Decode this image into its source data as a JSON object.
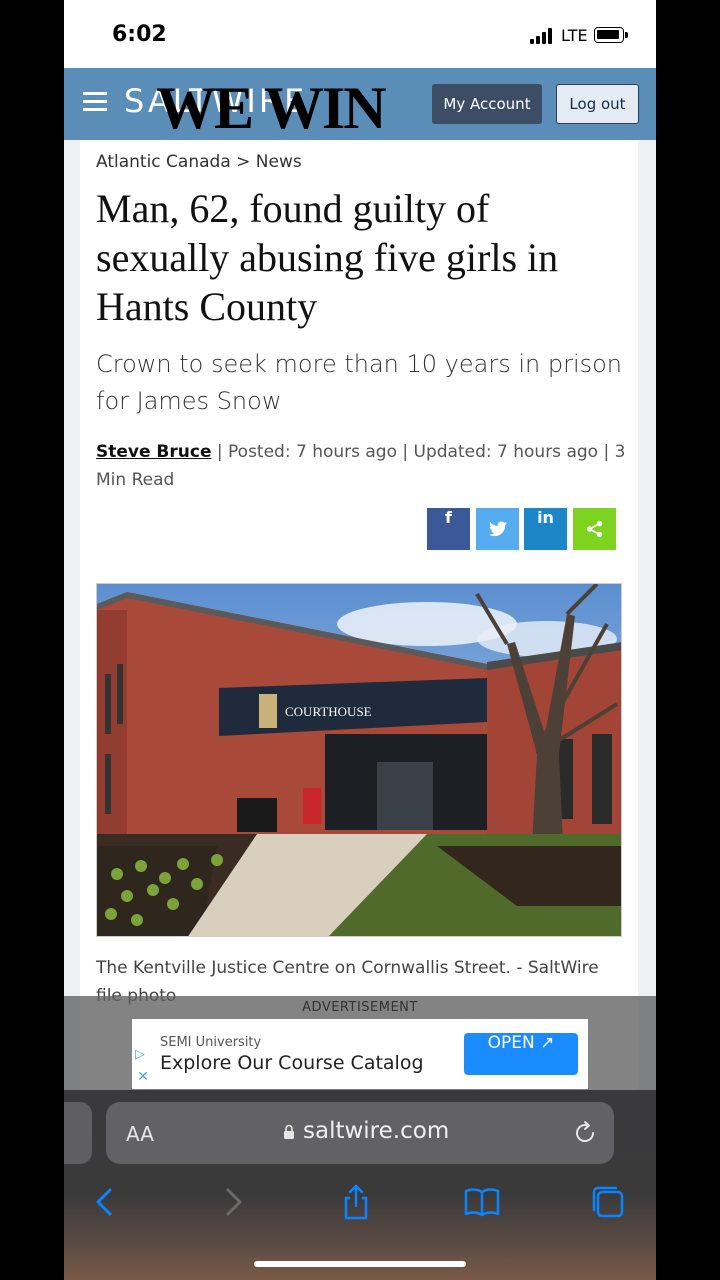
{
  "status_bar": {
    "time": "6:02",
    "network": "LTE"
  },
  "header": {
    "logo": "SALTWIRE",
    "overlay_text": "WE WIN",
    "account_label": "My Account",
    "logout_label": "Log out"
  },
  "article": {
    "breadcrumb": "Atlantic Canada > News",
    "headline": "Man, 62, found guilty of sexually abusing five girls in Hants County",
    "subheadline": "Crown to seek more than 10 years in prison for James Snow",
    "author": "Steve Bruce",
    "meta": " | Posted: 7 hours ago | Updated: 7 hours ago | 3 Min Read",
    "share": {
      "facebook": "f",
      "twitter": "t",
      "linkedin": "in"
    },
    "photo_sign": "COURTHOUSE",
    "caption": "The Kentville Justice Centre on Cornwallis Street. - SaltWire file photo"
  },
  "ad": {
    "label": "ADVERTISEMENT",
    "sponsor": "SEMI University",
    "title": "Explore Our Course Catalog",
    "button": "OPEN ↗"
  },
  "browser": {
    "aa_label": "AA",
    "url": "saltwire.com"
  },
  "colors": {
    "header_bg": "#5a8db8",
    "facebook": "#3b5998",
    "twitter": "#55acee",
    "linkedin": "#1b87c8",
    "share": "#7ed321",
    "ad_button": "#1a8cff",
    "safari_accent": "#0a84ff"
  },
  "icons": [
    "menu-icon",
    "lock-icon",
    "reload-icon",
    "back-icon",
    "forward-icon",
    "share-icon",
    "bookmarks-icon",
    "tabs-icon"
  ]
}
